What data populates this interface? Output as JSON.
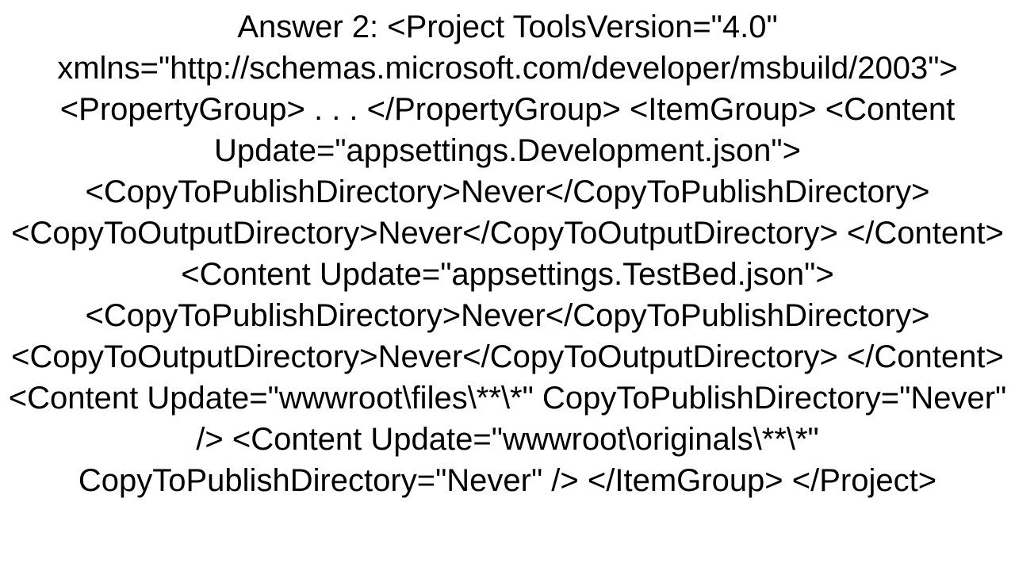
{
  "text": "Answer 2: <Project ToolsVersion=\"4.0\" xmlns=\"http://schemas.microsoft.com/developer/msbuild/2003\">   <PropertyGroup>     .     .     .   </PropertyGroup>    <ItemGroup>     <Content Update=\"appsettings.Development.json\">       <CopyToPublishDirectory>Never</CopyToPublishDirectory>       <CopyToOutputDirectory>Never</CopyToOutputDirectory>     </Content>     <Content Update=\"appsettings.TestBed.json\">       <CopyToPublishDirectory>Never</CopyToPublishDirectory>       <CopyToOutputDirectory>Never</CopyToOutputDirectory>     </Content>     <Content Update=\"wwwroot\\files\\**\\*\" CopyToPublishDirectory=\"Never\" />     <Content Update=\"wwwroot\\originals\\**\\*\" CopyToPublishDirectory=\"Never\" />   </ItemGroup> </Project>"
}
